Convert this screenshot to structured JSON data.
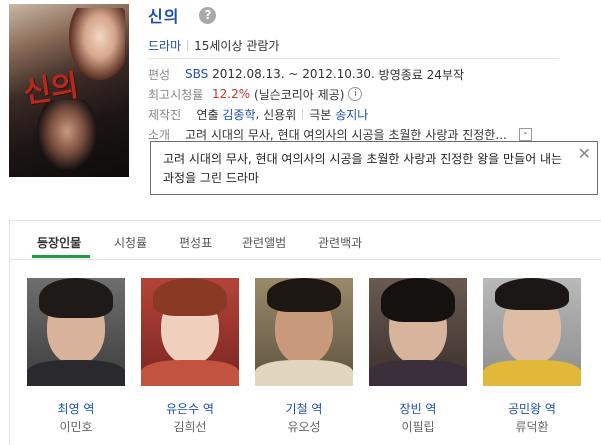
{
  "title": "신의",
  "genre": "드라마",
  "age_rating": "15세이상 관람가",
  "info": {
    "broadcast": {
      "label": "편성",
      "channel": "SBS",
      "period": "2012.08.13. ~ 2012.10.30.",
      "status": "방영종료",
      "episodes": "24부작"
    },
    "ratings": {
      "label": "최고시청률",
      "value": "12.2%",
      "source": "(닐슨코리아 제공)"
    },
    "staff": {
      "label": "제작진",
      "director_label": "연출",
      "director": "김종학",
      "director2": "신용휘",
      "writer_label": "극본",
      "writer": "송지나"
    },
    "synopsis": {
      "label": "소개",
      "short": "고려 시대의 무사, 현대 여의사의 시공을 초월한 사랑과 진정한...",
      "collapse": "-"
    }
  },
  "popup": {
    "text": "고려 시대의 무사, 현대 여의사의 시공을 초월한 사랑과 진정한 왕을 만들어 내는 과정을 그린 드라마",
    "close": "✕"
  },
  "tabs": [
    "등장인물",
    "시청률",
    "편성표",
    "관련앨범",
    "관련백과"
  ],
  "cast": [
    {
      "role": "최영 역",
      "actor": "이민호"
    },
    {
      "role": "유은수 역",
      "actor": "김희선"
    },
    {
      "role": "기철 역",
      "actor": "유오성"
    },
    {
      "role": "장빈 역",
      "actor": "이필립"
    },
    {
      "role": "공민왕 역",
      "actor": "류덕환"
    }
  ],
  "icons": {
    "help": "question-icon",
    "info": "info-icon",
    "close": "close-icon"
  },
  "colors": {
    "link": "#1e4fa8",
    "rating": "#c0392b",
    "tab_accent": "#1f9d3e"
  }
}
